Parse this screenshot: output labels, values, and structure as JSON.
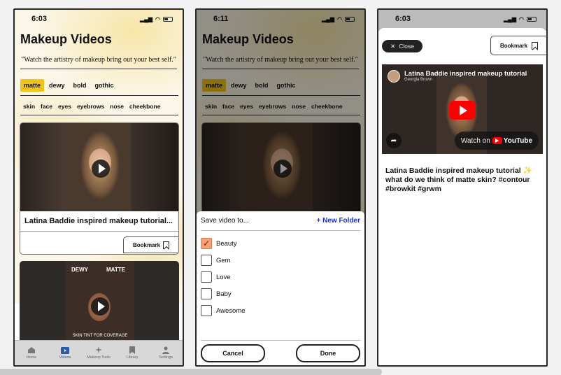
{
  "status": {
    "time1": "6:03",
    "time2": "6:11",
    "time3": "6:03"
  },
  "header": {
    "title": "Makeup Videos",
    "quote": "\"Watch the artistry of makeup bring out your best self.\""
  },
  "finishes": [
    "matte",
    "dewy",
    "bold",
    "gothic"
  ],
  "selected_finish": "matte",
  "tags": [
    "skin",
    "face",
    "eyes",
    "eyebrows",
    "nose",
    "cheekbone"
  ],
  "video_card": {
    "title": "Latina Baddie inspired makeup tutorial...",
    "bookmark_label": "Bookmark"
  },
  "video_card2": {
    "left_label": "DEWY",
    "right_label": "MATTE",
    "caption": "SKIN TINT FOR COVERAGE"
  },
  "tabbar": [
    "Home",
    "Videos",
    "Makeup Tools",
    "Library",
    "Settings"
  ],
  "active_tab": "Videos",
  "save_sheet": {
    "heading": "Save video to...",
    "new_folder": "+ New Folder",
    "folders": [
      {
        "name": "Beauty",
        "checked": true
      },
      {
        "name": "Gem",
        "checked": false
      },
      {
        "name": "Love",
        "checked": false
      },
      {
        "name": "Baby",
        "checked": false
      },
      {
        "name": "Awesome",
        "checked": false
      }
    ],
    "cancel": "Cancel",
    "done": "Done"
  },
  "detail": {
    "close_label": "Close",
    "bookmark_label": "Bookmark",
    "player_title": "Latina Baddie inspired makeup tutorial",
    "channel": "Georgia Brown",
    "watch_on": "Watch on",
    "youtube": "YouTube",
    "description_main": "Latina Baddie inspired makeup tutorial",
    "sparkle": "✨",
    "description_rest": " what do we think of matte skin? #contour #browkit #grwm"
  },
  "colors": {
    "accent_yellow": "#f2c418",
    "new_folder_blue": "#1a2fd8",
    "active_tab_blue": "#2a5aa8",
    "yt_red": "#ff0000"
  }
}
